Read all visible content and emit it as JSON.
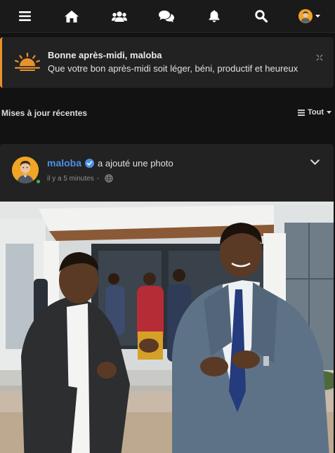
{
  "nav": {
    "items": [
      "menu-icon",
      "home-icon",
      "groups-icon",
      "chat-icon",
      "bell-icon",
      "search-icon",
      "profile-avatar"
    ]
  },
  "greeting": {
    "title": "Bonne après-midi, maloba",
    "message": "Que votre bon après-midi soit léger, béni, productif et heureux",
    "accent": "#e8922c"
  },
  "feed": {
    "heading": "Mises à jour récentes",
    "filter_label": "Tout"
  },
  "post": {
    "author": "maloba",
    "action": "a ajouté une photo",
    "time": "il y a 5 minutes",
    "separator": "-",
    "author_color": "#4d8fe6",
    "online": true
  }
}
